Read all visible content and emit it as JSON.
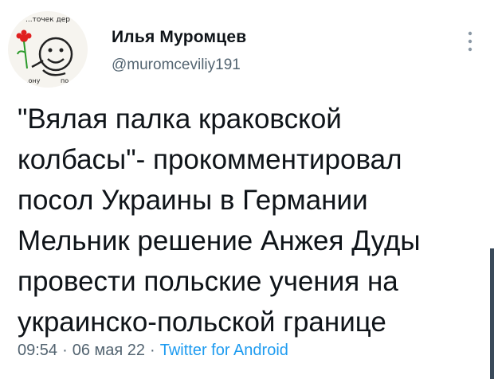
{
  "avatar": {
    "top_text": "...точек дер",
    "bottom_left_text": "...ону",
    "bottom_right_text": "по..."
  },
  "author": {
    "display_name": "Илья Муромцев",
    "handle": "@muromceviliy191"
  },
  "more_menu": {
    "icon": "more-vertical-icon"
  },
  "tweet": {
    "lines": [
      "\"Вялая палка краковской",
      "колбасы\"- прокомментировал",
      "посол Украины в Германии",
      "Мельник решение Анжея Дуды",
      "провести польские учения на",
      "украинско-польской границе"
    ]
  },
  "meta": {
    "time": "09:54",
    "separator": "·",
    "date": "06 мая 22",
    "source": "Twitter for Android"
  },
  "colors": {
    "text": "#0f1419",
    "secondary": "#536471",
    "link": "#1d9bf0",
    "scrollbar": "#3a4a5a"
  }
}
